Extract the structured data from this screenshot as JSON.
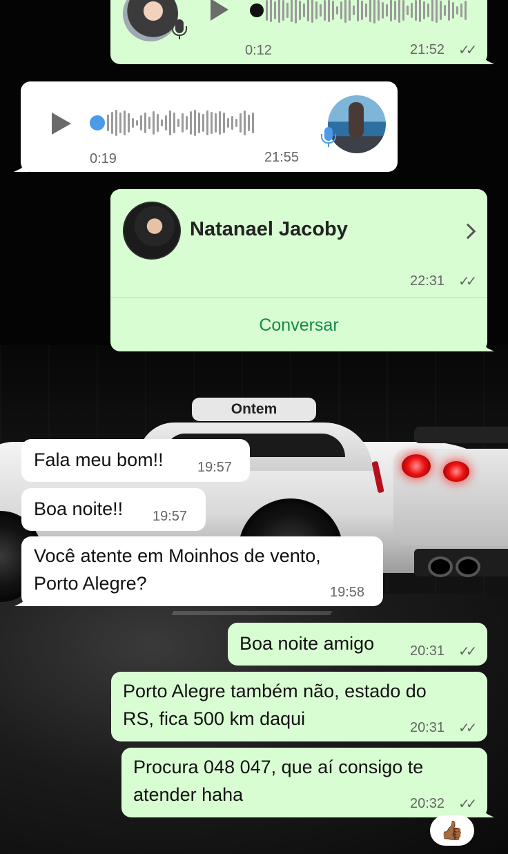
{
  "date_separator": "Ontem",
  "voice_notes": [
    {
      "id": "voice-out-1",
      "direction": "outgoing",
      "duration": "0:12",
      "time": "21:52",
      "ticks": "✓✓"
    },
    {
      "id": "voice-in-1",
      "direction": "incoming",
      "duration": "0:19",
      "time": "21:55"
    }
  ],
  "contact_card": {
    "name": "Natanael Jacoby",
    "time": "22:31",
    "ticks": "✓✓",
    "action_label": "Conversar"
  },
  "messages": [
    {
      "direction": "incoming",
      "text": "Fala meu bom!!",
      "time": "19:57"
    },
    {
      "direction": "incoming",
      "text": "Boa noite!!",
      "time": "19:57"
    },
    {
      "direction": "incoming",
      "text": "Você atente em Moinhos de vento,\nPorto Alegre?",
      "time": "19:58"
    },
    {
      "direction": "outgoing",
      "text": "Boa noite amigo",
      "time": "20:31",
      "ticks": "✓✓"
    },
    {
      "direction": "outgoing",
      "text": "Porto Alegre também não, estado do\nRS, fica 500 km daqui",
      "time": "20:31",
      "ticks": "✓✓"
    },
    {
      "direction": "outgoing",
      "text": "Procura 048 047, que aí consigo te\natender haha",
      "time": "20:32",
      "ticks": "✓✓"
    }
  ],
  "reaction": {
    "emoji": "👍🏾"
  },
  "colors": {
    "outgoing_bubble": "#d9fdd3",
    "incoming_bubble": "#ffffff",
    "link_green": "#188a4c",
    "mic_blue": "#4a9be8",
    "progress_blue": "#4a9be8"
  },
  "icons": [
    "play-icon",
    "microphone-icon",
    "chevron-right-icon",
    "double-check-icon"
  ]
}
